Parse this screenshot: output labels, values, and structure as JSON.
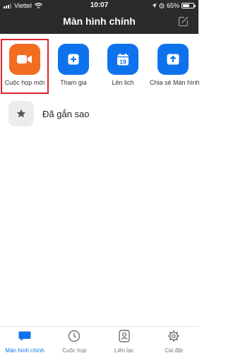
{
  "status_bar": {
    "carrier": "Viettel",
    "time": "10:07",
    "battery_percent": "65%",
    "battery_level": 0.65
  },
  "header": {
    "title": "Màn hình chính",
    "edit_icon": "edit-icon"
  },
  "actions": [
    {
      "label": "Cuộc họp mới",
      "icon": "video-camera-icon",
      "color": "#f26d21"
    },
    {
      "label": "Tham gia",
      "icon": "plus-icon",
      "color": "#0e72ed"
    },
    {
      "label": "Lên lịch",
      "icon": "calendar-icon",
      "calendar_day": "19",
      "color": "#0e72ed"
    },
    {
      "label": "Chia sẻ Màn hình",
      "icon": "share-screen-icon",
      "color": "#0e72ed"
    }
  ],
  "starred": {
    "label": "Đã gắn sao",
    "icon": "star-icon"
  },
  "tabs": [
    {
      "label": "Màn hình chính",
      "icon": "chat-bubble-icon",
      "active": true
    },
    {
      "label": "Cuộc họp",
      "icon": "clock-icon",
      "active": false
    },
    {
      "label": "Liên lạc",
      "icon": "contact-icon",
      "active": false
    },
    {
      "label": "Cài đặt",
      "icon": "gear-icon",
      "active": false
    }
  ],
  "colors": {
    "header_bg": "#2b2b2b",
    "accent": "#0e72ed",
    "selection_outline": "#d9262c"
  }
}
